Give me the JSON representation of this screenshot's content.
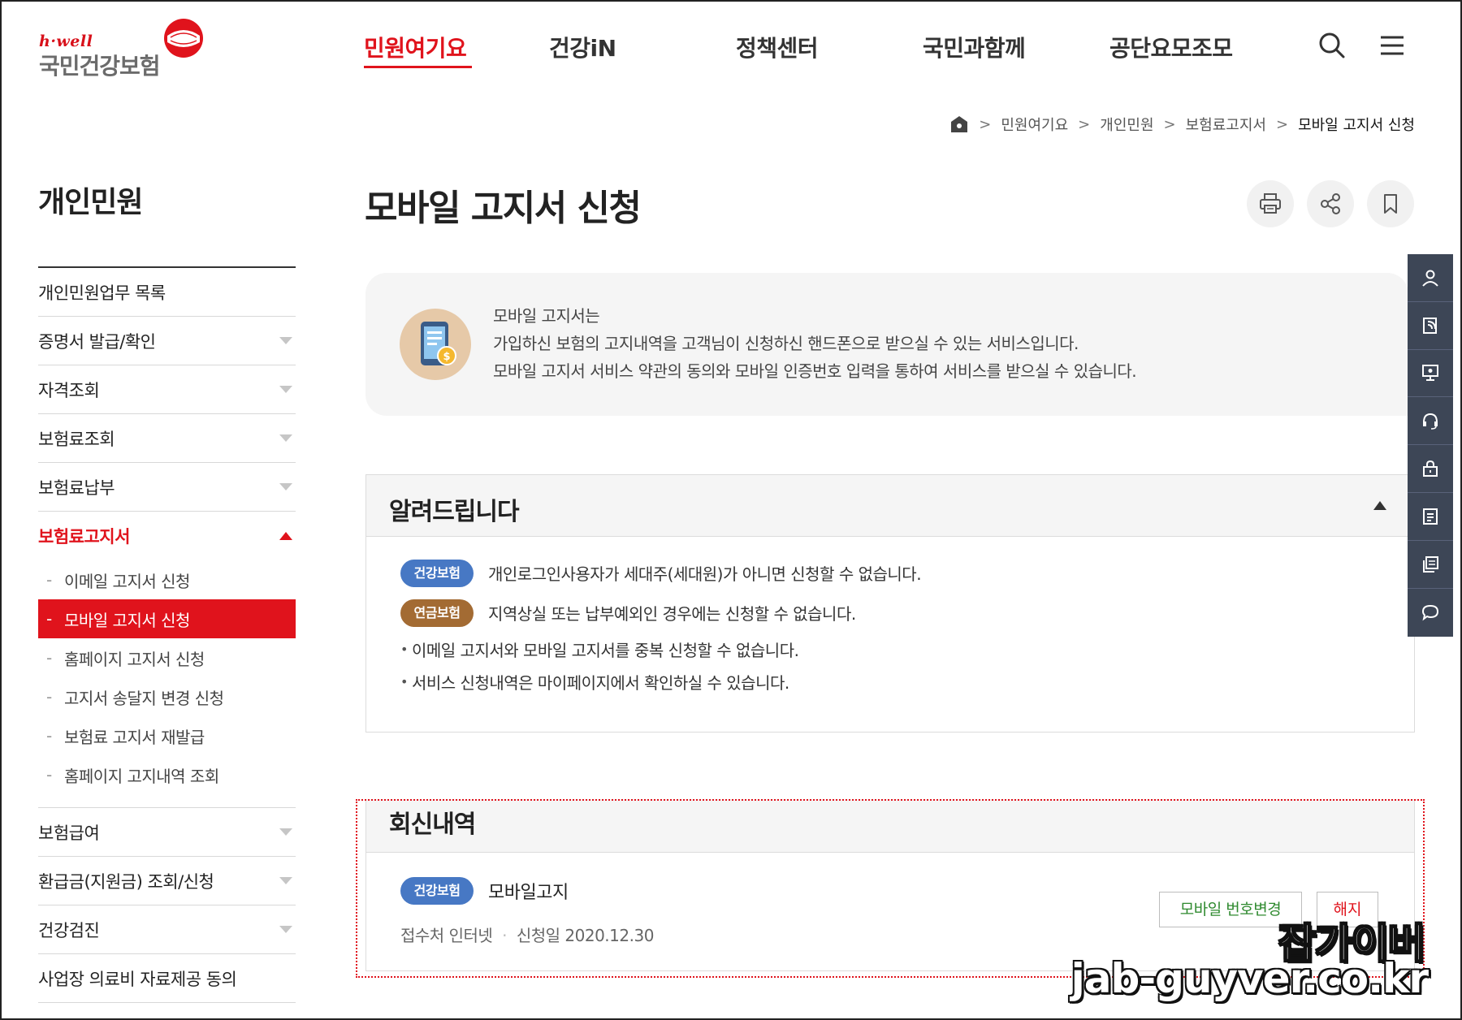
{
  "header": {
    "logo_brand": "h·well",
    "logo_org": "국민건강보험",
    "nav": [
      {
        "label": "민원여기요",
        "active": true
      },
      {
        "label": "건강iN"
      },
      {
        "label": "정책센터"
      },
      {
        "label": "국민과함께"
      },
      {
        "label": "공단요모조모"
      }
    ],
    "icons": [
      "search-icon",
      "hamburger-menu-icon"
    ],
    "accent_color": "#e0131c"
  },
  "breadcrumb": {
    "items": [
      "민원여기요",
      "개인민원",
      "보험료고지서",
      "모바일 고지서 신청"
    ]
  },
  "sidebar": {
    "title": "개인민원",
    "items": [
      {
        "label": "개인민원업무 목록",
        "has_arrow": false
      },
      {
        "label": "증명서 발급/확인",
        "has_arrow": true
      },
      {
        "label": "자격조회",
        "has_arrow": true
      },
      {
        "label": "보험료조회",
        "has_arrow": true
      },
      {
        "label": "보험료납부",
        "has_arrow": true
      },
      {
        "label": "보험료고지서",
        "expanded": true
      }
    ],
    "sub_items": [
      {
        "label": "이메일 고지서 신청"
      },
      {
        "label": "모바일 고지서 신청",
        "active": true
      },
      {
        "label": "홈페이지 고지서 신청"
      },
      {
        "label": "고지서 송달지 변경 신청"
      },
      {
        "label": "보험료 고지서 재발급"
      },
      {
        "label": "홈페이지 고지내역 조회"
      }
    ],
    "items_after": [
      {
        "label": "보험급여",
        "has_arrow": true
      },
      {
        "label": "환급금(지원금) 조회/신청",
        "has_arrow": true
      },
      {
        "label": "건강검진",
        "has_arrow": true
      },
      {
        "label": "사업장 의료비 자료제공 동의",
        "has_arrow": false
      }
    ]
  },
  "page": {
    "title": "모바일 고지서 신청",
    "tools": [
      "print-icon",
      "share-icon",
      "bookmark-icon"
    ]
  },
  "intro": {
    "lines": [
      "모바일 고지서는",
      "가입하신 보험의 고지내역을 고객님이 신청하신 핸드폰으로 받으실 수 있는 서비스입니다.",
      "모바일 고지서 서비스 약관의 동의와 모바일 인증번호 입력을 통하여 서비스를 받으실 수 있습니다."
    ]
  },
  "notice": {
    "title": "알려드립니다",
    "badge_rows": [
      {
        "badge": "건강보험",
        "color": "#4778c4",
        "text": "개인로그인사용자가 세대주(세대원)가 아니면 신청할 수 없습니다."
      },
      {
        "badge": "연금보험",
        "color": "#a36b33",
        "text": "지역상실 또는 납부예외인 경우에는 신청할 수 없습니다."
      }
    ],
    "bullets": [
      "이메일 고지서와 모바일 고지서를 중복 신청할 수 없습니다.",
      "서비스 신청내역은 마이페이지에서 확인하실 수 있습니다."
    ]
  },
  "reply": {
    "title": "회신내역",
    "badge": "건강보험",
    "service": "모바일고지",
    "receipt_label": "접수처",
    "receipt_value": "인터넷",
    "date_label": "신청일",
    "date_value": "2020.12.30",
    "change_button": "모바일 번호변경",
    "cancel_button": "해지"
  },
  "quickbar": {
    "icons": [
      "user-icon",
      "document-signal-icon",
      "monitor-icon",
      "headset-icon",
      "lock-icon",
      "list-document-icon",
      "layers-icon",
      "chat-bubble-icon"
    ]
  },
  "watermark": {
    "line1": "잡가이버",
    "line2": "jab-guyver.co.kr"
  }
}
